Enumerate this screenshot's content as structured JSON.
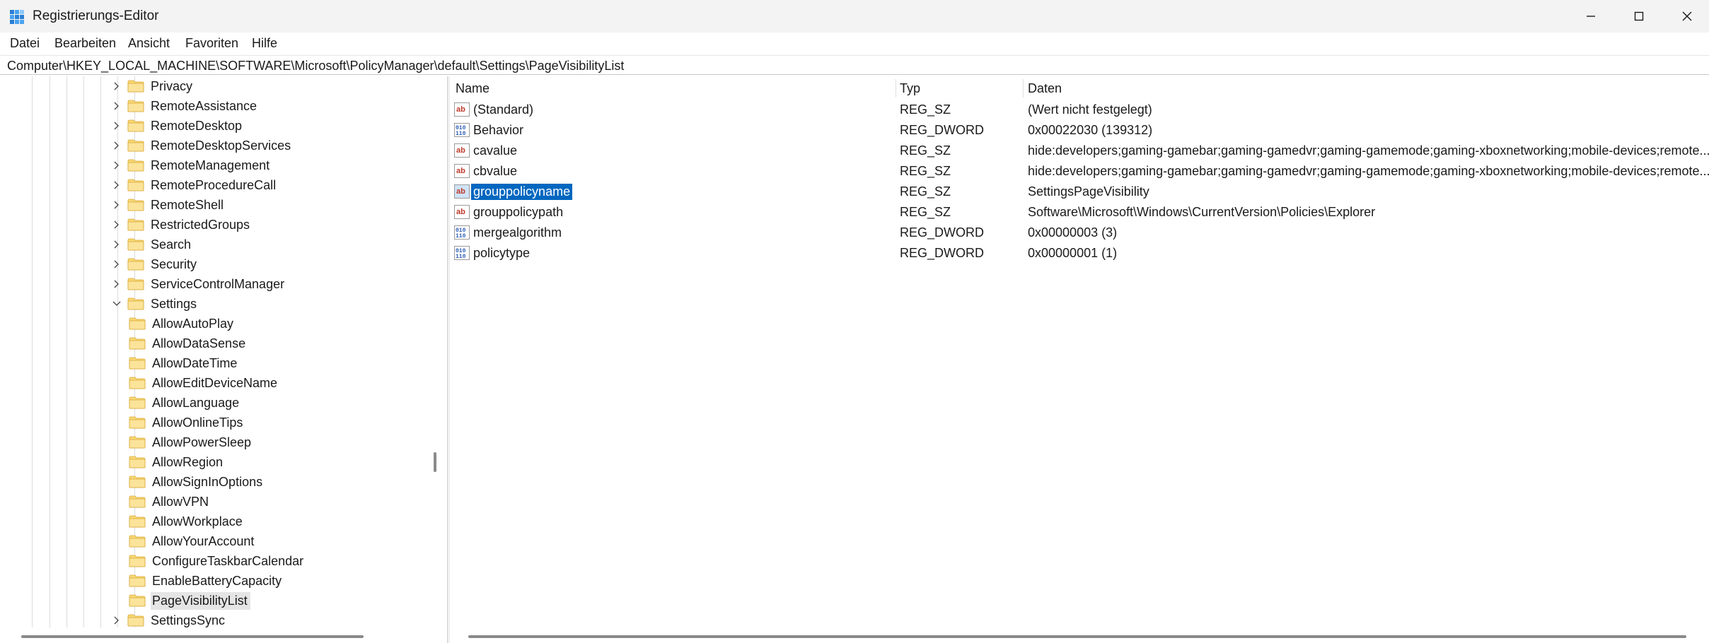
{
  "window": {
    "title": "Registrierungs-Editor",
    "icon": "registry-editor-icon"
  },
  "menu": [
    "Datei",
    "Bearbeiten",
    "Ansicht",
    "Favoriten",
    "Hilfe"
  ],
  "address": "Computer\\HKEY_LOCAL_MACHINE\\SOFTWARE\\Microsoft\\PolicyManager\\default\\Settings\\PageVisibilityList",
  "tree": {
    "items": [
      {
        "label": "Privacy",
        "level": 1,
        "expander": "collapsed"
      },
      {
        "label": "RemoteAssistance",
        "level": 1,
        "expander": "collapsed"
      },
      {
        "label": "RemoteDesktop",
        "level": 1,
        "expander": "collapsed"
      },
      {
        "label": "RemoteDesktopServices",
        "level": 1,
        "expander": "collapsed"
      },
      {
        "label": "RemoteManagement",
        "level": 1,
        "expander": "collapsed"
      },
      {
        "label": "RemoteProcedureCall",
        "level": 1,
        "expander": "collapsed"
      },
      {
        "label": "RemoteShell",
        "level": 1,
        "expander": "collapsed"
      },
      {
        "label": "RestrictedGroups",
        "level": 1,
        "expander": "collapsed"
      },
      {
        "label": "Search",
        "level": 1,
        "expander": "collapsed"
      },
      {
        "label": "Security",
        "level": 1,
        "expander": "collapsed"
      },
      {
        "label": "ServiceControlManager",
        "level": 1,
        "expander": "collapsed"
      },
      {
        "label": "Settings",
        "level": 1,
        "expander": "expanded"
      },
      {
        "label": "AllowAutoPlay",
        "level": 2,
        "expander": "none"
      },
      {
        "label": "AllowDataSense",
        "level": 2,
        "expander": "none"
      },
      {
        "label": "AllowDateTime",
        "level": 2,
        "expander": "none"
      },
      {
        "label": "AllowEditDeviceName",
        "level": 2,
        "expander": "none"
      },
      {
        "label": "AllowLanguage",
        "level": 2,
        "expander": "none"
      },
      {
        "label": "AllowOnlineTips",
        "level": 2,
        "expander": "none"
      },
      {
        "label": "AllowPowerSleep",
        "level": 2,
        "expander": "none"
      },
      {
        "label": "AllowRegion",
        "level": 2,
        "expander": "none"
      },
      {
        "label": "AllowSignInOptions",
        "level": 2,
        "expander": "none"
      },
      {
        "label": "AllowVPN",
        "level": 2,
        "expander": "none"
      },
      {
        "label": "AllowWorkplace",
        "level": 2,
        "expander": "none"
      },
      {
        "label": "AllowYourAccount",
        "level": 2,
        "expander": "none"
      },
      {
        "label": "ConfigureTaskbarCalendar",
        "level": 2,
        "expander": "none"
      },
      {
        "label": "EnableBatteryCapacity",
        "level": 2,
        "expander": "none"
      },
      {
        "label": "PageVisibilityList",
        "level": 2,
        "expander": "none",
        "selected": true
      },
      {
        "label": "SettingsSync",
        "level": 1,
        "expander": "collapsed"
      }
    ]
  },
  "values": {
    "columns": {
      "name": "Name",
      "type": "Typ",
      "data": "Daten"
    },
    "rows": [
      {
        "name": "(Standard)",
        "type": "REG_SZ",
        "data": "(Wert nicht festgelegt)",
        "icon": "string-value-icon"
      },
      {
        "name": "Behavior",
        "type": "REG_DWORD",
        "data": "0x00022030 (139312)",
        "icon": "binary-value-icon"
      },
      {
        "name": "cavalue",
        "type": "REG_SZ",
        "data": "hide:developers;gaming-gamebar;gaming-gamedvr;gaming-gamemode;gaming-xboxnetworking;mobile-devices;remote...",
        "icon": "string-value-icon"
      },
      {
        "name": "cbvalue",
        "type": "REG_SZ",
        "data": "hide:developers;gaming-gamebar;gaming-gamedvr;gaming-gamemode;gaming-xboxnetworking;mobile-devices;remote...",
        "icon": "string-value-icon"
      },
      {
        "name": "grouppolicyname",
        "type": "REG_SZ",
        "data": "SettingsPageVisibility",
        "icon": "string-value-icon",
        "selected": true
      },
      {
        "name": "grouppolicypath",
        "type": "REG_SZ",
        "data": "Software\\Microsoft\\Windows\\CurrentVersion\\Policies\\Explorer",
        "icon": "string-value-icon"
      },
      {
        "name": "mergealgorithm",
        "type": "REG_DWORD",
        "data": "0x00000003 (3)",
        "icon": "binary-value-icon"
      },
      {
        "name": "policytype",
        "type": "REG_DWORD",
        "data": "0x00000001 (1)",
        "icon": "binary-value-icon"
      }
    ]
  },
  "colors": {
    "selection": "#0067c0",
    "folder": "#f8d775",
    "string_icon": "#c0392b",
    "binary_icon": "#2f5eb6"
  }
}
